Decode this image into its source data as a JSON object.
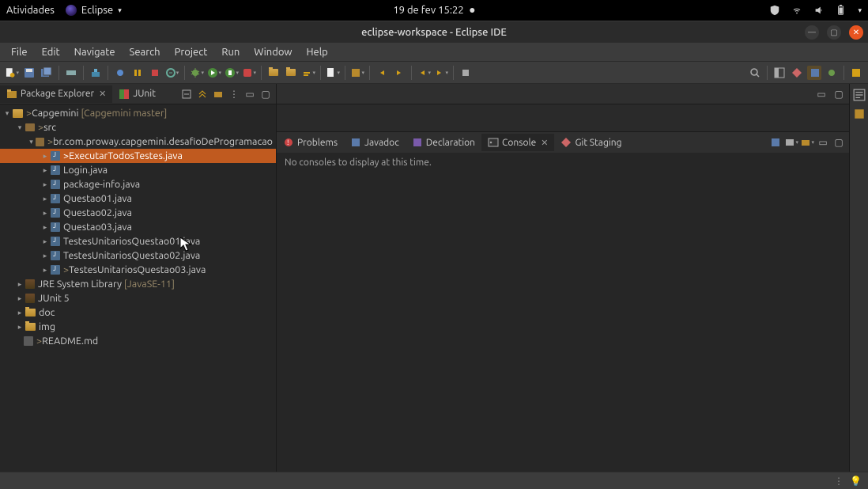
{
  "gnome": {
    "activities": "Atividades",
    "app_name": "Eclipse",
    "clock": "19 de fev  15:22"
  },
  "window": {
    "title": "eclipse-workspace - Eclipse IDE"
  },
  "menubar": [
    "File",
    "Edit",
    "Navigate",
    "Search",
    "Project",
    "Run",
    "Window",
    "Help"
  ],
  "views": {
    "pkg_explorer": "Package Explorer",
    "junit": "JUnit"
  },
  "tree": {
    "project": "Capgemini",
    "project_decor": "[Capgemini master]",
    "src": "src",
    "pkg": "br.com.proway.capgemini.desafioDeProgramacao",
    "files": [
      "ExecutarTodosTestes.java",
      "Login.java",
      "package-info.java",
      "Questao01.java",
      "Questao02.java",
      "Questao03.java",
      "TestesUnitariosQuestao01.java",
      "TestesUnitariosQuestao02.java",
      "TestesUnitariosQuestao03.java"
    ],
    "jre": "JRE System Library",
    "jre_decor": "[JavaSE-11]",
    "junit5": "JUnit 5",
    "doc": "doc",
    "img": "img",
    "readme": "README.md"
  },
  "bottom_tabs": {
    "problems": "Problems",
    "javadoc": "Javadoc",
    "declaration": "Declaration",
    "console": "Console",
    "git_staging": "Git Staging"
  },
  "console_msg": "No consoles to display at this time.",
  "dirty_prefix": "> "
}
